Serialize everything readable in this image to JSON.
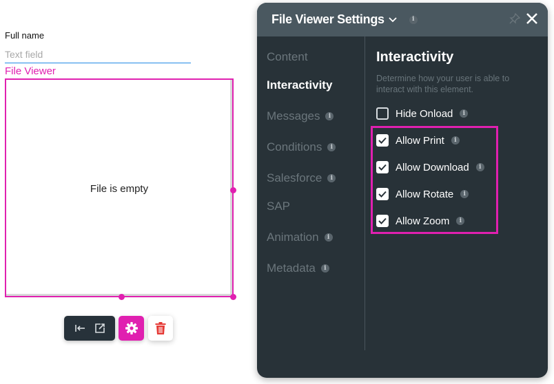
{
  "canvas": {
    "field_label": "Full name",
    "field_placeholder": "Text field",
    "file_viewer_label": "File Viewer",
    "file_viewer_empty_text": "File is empty",
    "accent_color": "#e020b0"
  },
  "toolbar": {
    "buttons": [
      {
        "name": "align-left",
        "icon": "arrow-to-left-icon"
      },
      {
        "name": "open-external",
        "icon": "external-link-icon"
      },
      {
        "name": "settings",
        "icon": "gear-icon"
      },
      {
        "name": "delete",
        "icon": "trash-icon"
      }
    ]
  },
  "panel": {
    "title": "File Viewer Settings",
    "nav": [
      {
        "label": "Content",
        "info": false,
        "active": false
      },
      {
        "label": "Interactivity",
        "info": false,
        "active": true
      },
      {
        "label": "Messages",
        "info": true,
        "active": false
      },
      {
        "label": "Conditions",
        "info": true,
        "active": false
      },
      {
        "label": "Salesforce",
        "info": true,
        "active": false
      },
      {
        "label": "SAP",
        "info": false,
        "active": false
      },
      {
        "label": "Animation",
        "info": true,
        "active": false
      },
      {
        "label": "Metadata",
        "info": true,
        "active": false
      }
    ],
    "section": {
      "title": "Interactivity",
      "description": "Determine how your user is able to interact with this element.",
      "options": [
        {
          "label": "Hide Onload",
          "checked": false
        },
        {
          "label": "Allow Print",
          "checked": true
        },
        {
          "label": "Allow Download",
          "checked": true
        },
        {
          "label": "Allow Rotate",
          "checked": true
        },
        {
          "label": "Allow Zoom",
          "checked": true
        }
      ]
    },
    "info_glyph": "i"
  }
}
